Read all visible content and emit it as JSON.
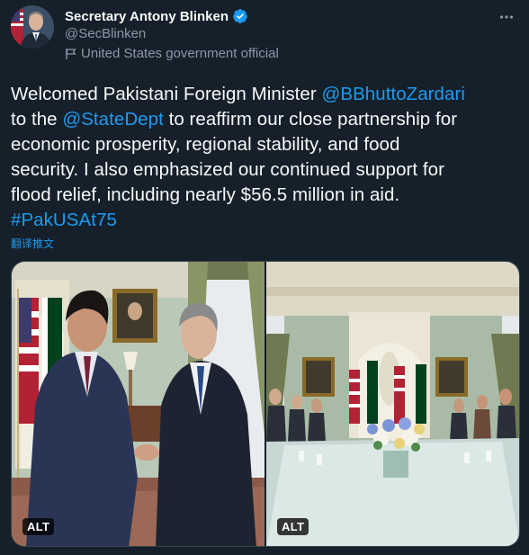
{
  "author": {
    "display_name": "Secretary Antony Blinken",
    "handle": "@SecBlinken",
    "label": "United States government official",
    "verified": true
  },
  "tweet": {
    "lines": [
      [
        {
          "t": "Welcomed Pakistani Foreign Minister ",
          "link": false
        },
        {
          "t": "@BBhuttoZardari",
          "link": true
        }
      ],
      [
        {
          "t": "to the ",
          "link": false
        },
        {
          "t": "@StateDept",
          "link": true
        },
        {
          "t": " to reaffirm our close partnership for",
          "link": false
        }
      ],
      [
        {
          "t": "economic prosperity, regional stability, and food",
          "link": false
        }
      ],
      [
        {
          "t": "security. I also emphasized our continued support for",
          "link": false
        }
      ],
      [
        {
          "t": "flood relief, including nearly $56.5 million in aid.",
          "link": false
        }
      ],
      [
        {
          "t": "#PakUSAt75",
          "link": true
        }
      ]
    ],
    "translate_label": "翻译推文"
  },
  "media": {
    "left_alt_label": "ALT",
    "right_alt_label": "ALT"
  },
  "icons": {
    "more": "more-icon",
    "verified": "verified-badge-icon",
    "government": "flag-icon"
  },
  "colors": {
    "background": "#15202b",
    "link": "#1d9bf0",
    "secondary_text": "#8b98a5",
    "verified": "#1d9bf0"
  }
}
